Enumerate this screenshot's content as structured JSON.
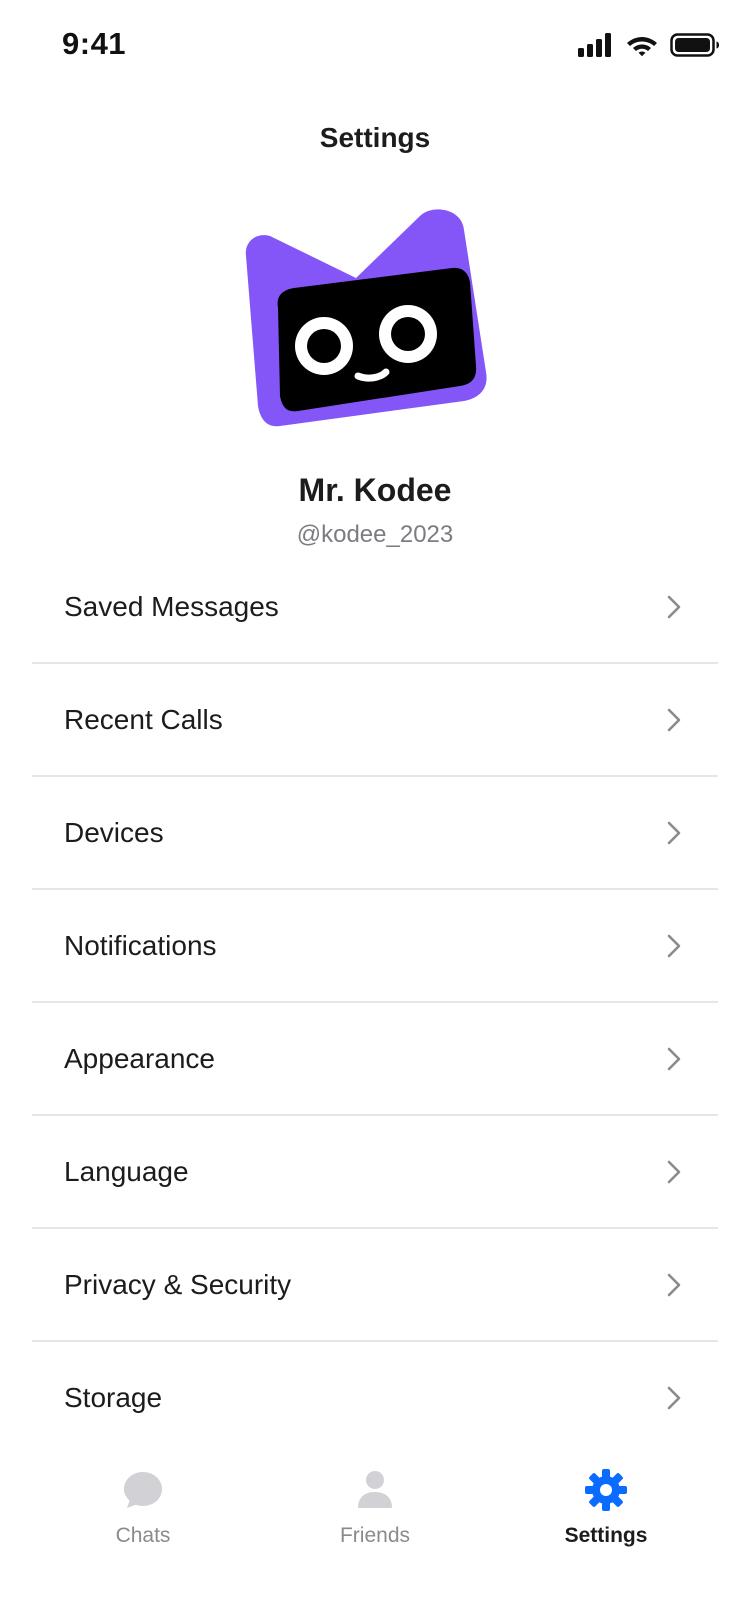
{
  "status_bar": {
    "time": "9:41"
  },
  "header": {
    "title": "Settings"
  },
  "profile": {
    "name": "Mr. Kodee",
    "handle": "@kodee_2023",
    "avatar_color": "#8456F7"
  },
  "menu": {
    "items": [
      {
        "label": "Saved Messages",
        "icon": "chevron-right-icon"
      },
      {
        "label": "Recent Calls",
        "icon": "chevron-right-icon"
      },
      {
        "label": "Devices",
        "icon": "chevron-right-icon"
      },
      {
        "label": "Notifications",
        "icon": "chevron-right-icon"
      },
      {
        "label": "Appearance",
        "icon": "chevron-right-icon"
      },
      {
        "label": "Language",
        "icon": "chevron-right-icon"
      },
      {
        "label": "Privacy & Security",
        "icon": "chevron-right-icon"
      },
      {
        "label": "Storage",
        "icon": "chevron-right-icon"
      }
    ]
  },
  "tab_bar": {
    "tabs": [
      {
        "label": "Chats",
        "icon": "chat-bubble-icon",
        "active": false
      },
      {
        "label": "Friends",
        "icon": "person-icon",
        "active": false
      },
      {
        "label": "Settings",
        "icon": "gear-icon",
        "active": true
      }
    ],
    "active_color": "#0A6CFF",
    "inactive_color": "#D1D1D6"
  }
}
